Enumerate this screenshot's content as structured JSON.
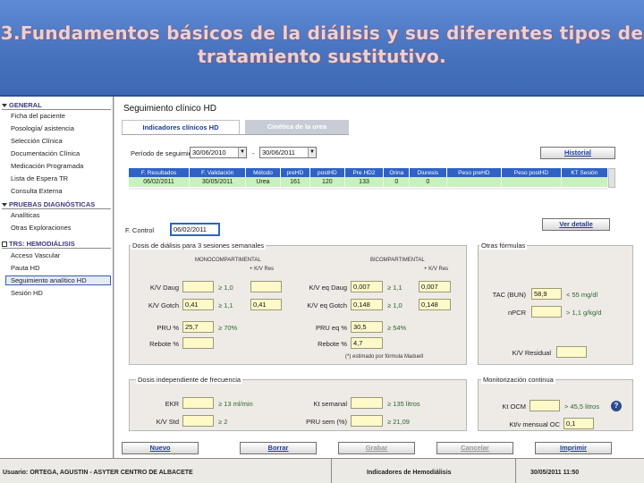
{
  "slide": {
    "title": "3.Fundamentos básicos de la diálisis y sus diferentes tipos de tratamiento sustitutivo."
  },
  "sidebar": {
    "general": {
      "header": "GENERAL",
      "items": [
        "Ficha del paciente",
        "Posología/ asistencia",
        "Selección Clínica",
        "Documentación Clínica",
        "Medicación Programada",
        "Lista de Espera TR",
        "Consulta Externa"
      ]
    },
    "pruebas": {
      "header": "PRUEBAS DIAGNÓSTICAS",
      "items": [
        "Analíticas",
        "Otras Exploraciones"
      ]
    },
    "trs": {
      "header": "TRS: HEMODIÁLISIS",
      "items": [
        "Acceso Vascular",
        "Pauta HD",
        "Seguimiento analítico HD",
        "Sesión HD"
      ],
      "selected_index": 2
    }
  },
  "main": {
    "title": "Seguimiento clínico HD",
    "tabs": [
      "Indicadores clínicos HD",
      "Cinética de la urea"
    ],
    "period": {
      "label": "Período de seguimiento:",
      "from": "30/06/2010",
      "sep": "-",
      "to": "30/06/2011"
    },
    "history_button": "Historial",
    "grid": {
      "columns": [
        "F. Resultados",
        "F. Validación",
        "Método",
        "preHD",
        "postHD",
        "Pre HD2",
        "Orina",
        "Diuresis",
        "Peso preHD",
        "Peso postHD",
        "KT Sesión"
      ],
      "rows": [
        [
          "06/02/2011",
          "30/05/2011",
          "Urea",
          "161",
          "120",
          "133",
          "0",
          "0",
          "",
          "",
          ""
        ]
      ]
    },
    "control": {
      "label": "F. Control",
      "value": "06/02/2011"
    },
    "detail_button": "Ver detalle",
    "dosis": {
      "title": "Dosis de diálisis para 3 sesiones semanales",
      "mono": {
        "header": "MONOCOMPARTIMENTAL",
        "unit": "+ K/V Res",
        "rows": [
          {
            "label": "K/V Daug",
            "v1": "",
            "hint": "≥ 1,0",
            "v2": ""
          },
          {
            "label": "K/V Gotch",
            "v1": "0,41",
            "hint": "≥ 1,1",
            "v2": "0,41"
          },
          {
            "label": "PRU %",
            "v1": "25,7",
            "hint": "≥ 70%",
            "v2": ""
          },
          {
            "label": "Rebote %",
            "v1": "",
            "hint": "",
            "v2": ""
          }
        ]
      },
      "bi": {
        "header": "BICOMPARTIMENTAL",
        "unit": "+ K/V Res",
        "rows": [
          {
            "label": "K/V eq Daug",
            "v1": "0,007",
            "hint": "≥ 1,1",
            "v2": "0,007"
          },
          {
            "label": "K/V eq Gotch",
            "v1": "0,148",
            "hint": "≥ 1,0",
            "v2": "0,148"
          },
          {
            "label": "PRU eq %",
            "v1": "30,5",
            "hint": "≥ 54%",
            "v2": ""
          },
          {
            "label": "Rebote %",
            "v1": "4,7",
            "hint": "",
            "v2": ""
          }
        ]
      },
      "note": "(*) estimado por fórmula Maduell"
    },
    "otras": {
      "title": "Otras fórmulas",
      "rows": [
        {
          "label": "TAC (BUN)",
          "value": "58,9",
          "hint": "< 55 mg/dl"
        },
        {
          "label": "nPCR",
          "value": "",
          "hint": "> 1,1 g/kg/d"
        }
      ],
      "residual_label": "K/V Residual",
      "residual_value": ""
    },
    "independiente": {
      "title": "Dosis independiente de frecuencia",
      "rows": [
        {
          "label": "EKR",
          "value": "",
          "hint": "≥ 13 ml/min"
        },
        {
          "label": "K/V Std",
          "value": "",
          "hint": "≥ 2"
        }
      ],
      "rows_right": [
        {
          "label": "Kt semanal",
          "value": "",
          "hint": "≥ 135 litros"
        },
        {
          "label": "PRU sem (%)",
          "value": "",
          "hint": "≥ 21,09"
        }
      ]
    },
    "monitor": {
      "title": "Monitorización continua",
      "rows": [
        {
          "label": "Kt OCM",
          "value": "",
          "hint": "> 45,5 litros"
        },
        {
          "label": "Kt/v mensual OC",
          "value": "0,1"
        }
      ]
    }
  },
  "buttons": {
    "nuevo": "Nuevo",
    "borrar": "Borrar",
    "grabar": "Grabar",
    "cancelar": "Cancelar",
    "imprimir": "Imprimir"
  },
  "footer": {
    "user": "Usuario: ORTEGA, AGUSTIN - ASYTER CENTRO DE ALBACETE",
    "module": "Indicadores de Hemodiálisis",
    "datetime": "30/05/2011   11:50"
  }
}
